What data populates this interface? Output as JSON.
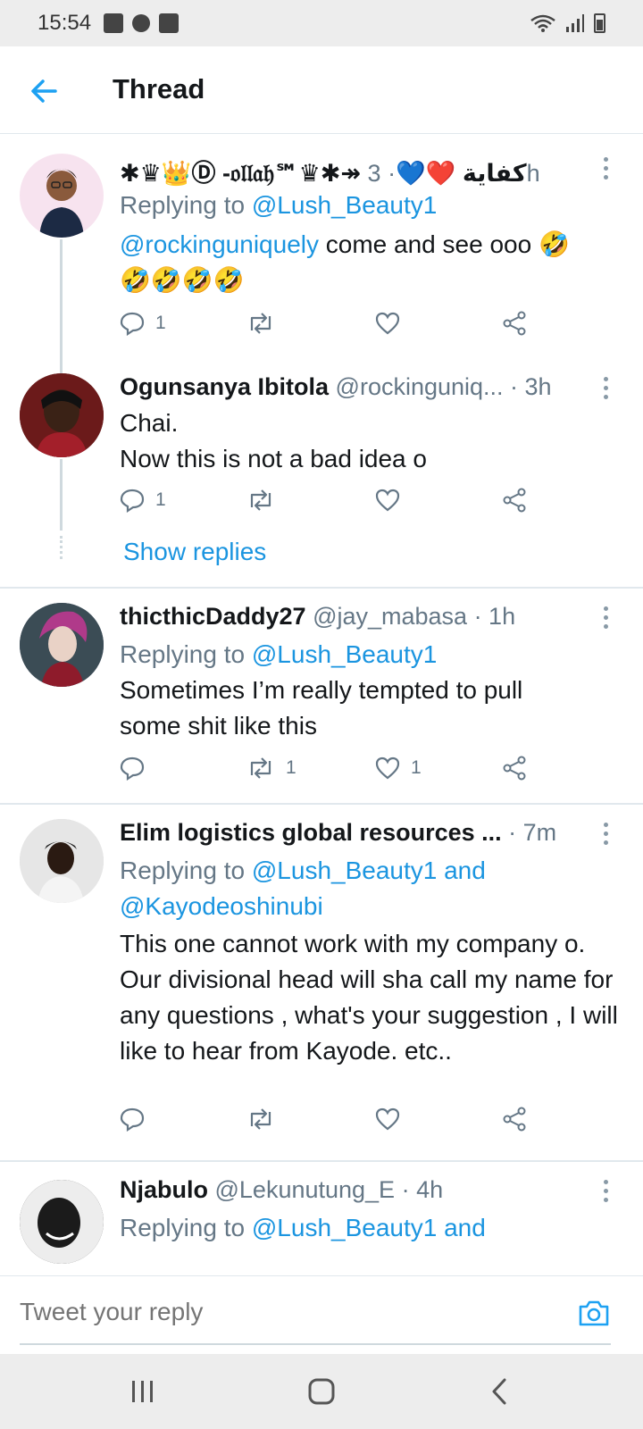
{
  "status": {
    "time": "15:54"
  },
  "header": {
    "title": "Thread"
  },
  "tweets": [
    {
      "name": "✱♛👑Ⓓ -𝔬𝔩𝔩𝔞𝔥℠♛✱↠ كفاية ❤️💙",
      "handle": "",
      "time": "· 3h",
      "reply_prefix": "Replying to ",
      "reply_to": "@Lush_Beauty1",
      "mention": "@rockinguniquely",
      "text": " come and see ooo 🤣\n🤣🤣🤣🤣",
      "replies": "1",
      "retweets": "",
      "likes": ""
    },
    {
      "name": "Ogunsanya Ibitola",
      "handle": " @rockinguniq...",
      "time": " · 3h",
      "text_line1": "Chai.",
      "text_line2": "Now this is not a bad idea o",
      "replies": "1",
      "retweets": "",
      "likes": "",
      "show_replies": "Show replies"
    },
    {
      "name": "thicthicDaddy27",
      "handle": " @jay_mabasa",
      "time": " · 1h",
      "reply_prefix": "Replying to ",
      "reply_to": "@Lush_Beauty1",
      "text": "Sometimes I’m really tempted to pull some shit like this",
      "replies": "",
      "retweets": "1",
      "likes": "1"
    },
    {
      "name": "Elim logistics global resources ...",
      "handle": "",
      "time": " · 7m",
      "reply_prefix": "Replying to ",
      "reply_to": "@Lush_Beauty1 and",
      "reply_to_2": "@Kayodeoshinubi",
      "text": "This one cannot work with my company o. Our divisional head will sha call my name for any questions , what's your suggestion , I will like to hear from Kayode. etc..",
      "replies": "",
      "retweets": "",
      "likes": ""
    },
    {
      "name": "Njabulo",
      "handle": " @Lekunutung_E",
      "time": " · 4h",
      "reply_prefix": "Replying to ",
      "reply_to": "@Lush_Beauty1 and"
    }
  ],
  "composer": {
    "placeholder": "Tweet your reply"
  },
  "colors": {
    "accent": "#1da1f2",
    "link": "#1b95e0",
    "muted": "#657786",
    "like_red": "#e0245e"
  }
}
